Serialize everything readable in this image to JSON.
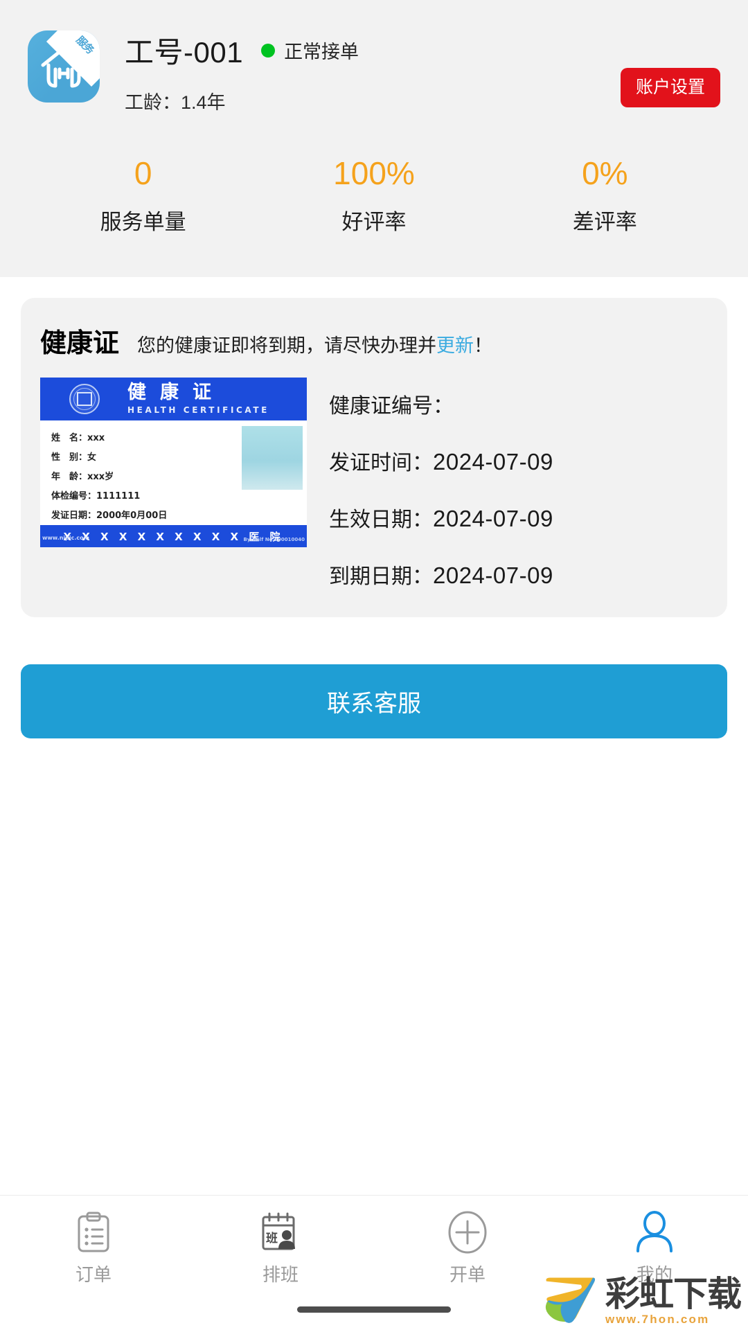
{
  "profile": {
    "avatar_badge": "服务",
    "employee_id": "工号-001",
    "status": "正常接单",
    "status_color": "#00c321",
    "tenure": "工龄：1.4年",
    "settings_button": "账户设置",
    "settings_color": "#e2121b"
  },
  "stats": [
    {
      "value": "0",
      "label": "服务单量"
    },
    {
      "value": "100%",
      "label": "好评率"
    },
    {
      "value": "0%",
      "label": "差评率"
    }
  ],
  "stats_value_color": "#f5a21c",
  "health_cert": {
    "title": "健康证",
    "notice_prefix": "您的健康证即将到期，请尽快办理并",
    "notice_link": "更新",
    "notice_suffix": "！",
    "link_color": "#3aabe0",
    "preview": {
      "header_cn": "健康证",
      "header_en": "HEALTH CERTIFICATE",
      "fields": [
        "姓　名：xxx",
        "性　别：女",
        "年　龄：xxx岁",
        "体检编号：1111111",
        "发证日期：2000年0月00日"
      ],
      "footer": "X X X X X X X X X X 医 院",
      "watermark_left": "www.nipic.com",
      "watermark_right": "By:Half No:200010040"
    },
    "info": [
      {
        "label": "健康证编号：",
        "value": ""
      },
      {
        "label": "发证时间：",
        "value": "2024-07-09"
      },
      {
        "label": "生效日期：",
        "value": "2024-07-09"
      },
      {
        "label": "到期日期：",
        "value": "2024-07-09"
      }
    ]
  },
  "contact_button": {
    "label": "联系客服",
    "color": "#1f9ed4"
  },
  "tabbar": [
    {
      "label": "订单",
      "icon": "clipboard-list-icon",
      "active": false
    },
    {
      "label": "排班",
      "icon": "schedule-person-icon",
      "active": false
    },
    {
      "label": "开单",
      "icon": "plus-circle-icon",
      "active": false
    },
    {
      "label": "我的",
      "icon": "user-icon",
      "active": true
    }
  ],
  "watermark": {
    "title": "彩虹下载",
    "url": "www.7hon.com"
  }
}
